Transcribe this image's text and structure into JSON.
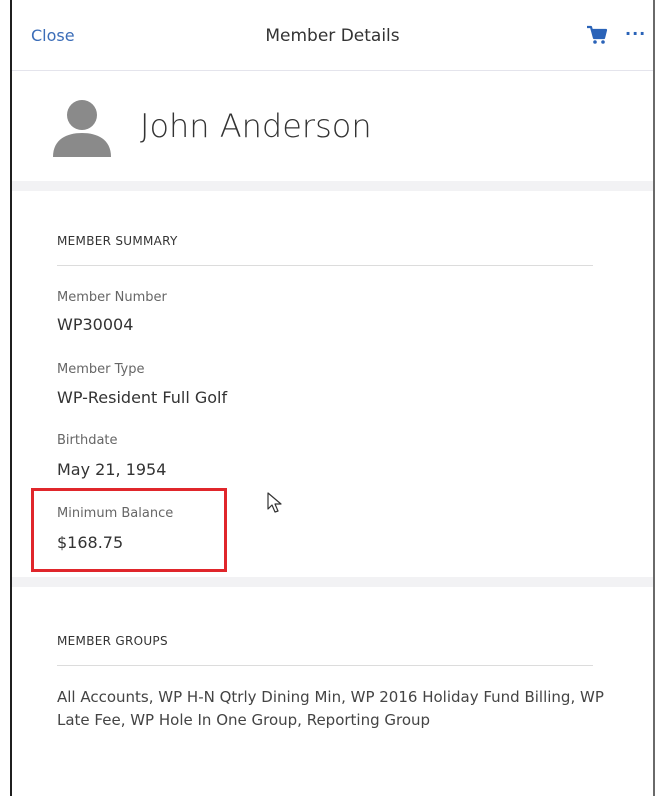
{
  "header": {
    "close_label": "Close",
    "title": "Member Details",
    "cart_icon": "shopping-cart-icon",
    "more_icon": "more-options-icon",
    "more_glyph": "···",
    "accent_color": "#2a63b8"
  },
  "profile": {
    "name": "John Anderson",
    "avatar_icon": "user-silhouette-icon"
  },
  "summary": {
    "section_title": "MEMBER SUMMARY",
    "fields": [
      {
        "label": "Member Number",
        "value": "WP30004"
      },
      {
        "label": "Member Type",
        "value": "WP-Resident Full Golf"
      },
      {
        "label": "Birthdate",
        "value": "May 21, 1954"
      },
      {
        "label": "Minimum Balance",
        "value": "$168.75"
      }
    ],
    "highlight_color": "#e0262b"
  },
  "groups": {
    "section_title": "MEMBER GROUPS",
    "text": "All Accounts, WP H-N Qtrly Dining Min, WP 2016 Holiday Fund Billing, WP Late Fee, WP Hole In One Group, Reporting Group"
  }
}
